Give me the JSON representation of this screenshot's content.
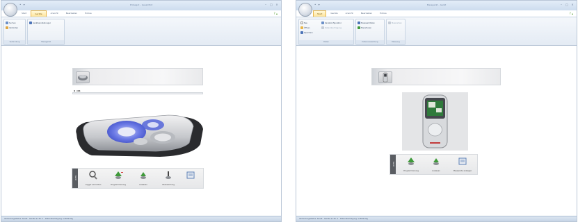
{
  "left_window": {
    "title": "Probegut – Gesamtkit",
    "quick_access": "• ▾",
    "controls": {
      "minimize": "–",
      "maximize": "□",
      "close": "×"
    },
    "tabs": [
      "Start",
      "Geräte",
      "Ansicht",
      "Bearbeiten",
      "Extras"
    ],
    "active_tab": 1,
    "ribbon_help": "? ▴",
    "ribbon_groups": [
      {
        "label": "Verbindung",
        "buttons": [
          "Suchen",
          "Verbinden"
        ]
      },
      {
        "label": "Messgerät",
        "buttons": [
          "Geräteeinstellungen"
        ]
      }
    ],
    "device_header_label": "",
    "progress_label": "0 / 66",
    "toolbar_tab": "Gerät",
    "toolbar_items": [
      {
        "label": "Logger einrichten",
        "icon": "search-icon"
      },
      {
        "label": "Programmierung",
        "icon": "program-icon"
      },
      {
        "label": "Auslesen",
        "icon": "read-icon"
      },
      {
        "label": "Überwachung",
        "icon": "monitor-icon"
      },
      {
        "label": "",
        "icon": "export-icon"
      }
    ],
    "status": "Verbindungsstatus: bereit · Geräte an PC: 1 · Datenübertragung: vollständig"
  },
  "right_window": {
    "title": "Messgerät – Gerät",
    "quick_access": "• ▾",
    "controls": {
      "minimize": "–",
      "maximize": "□",
      "close": "×"
    },
    "tabs": [
      "Start",
      "Geräte",
      "Ansicht",
      "Bearbeiten",
      "Extras"
    ],
    "active_tab": 0,
    "ribbon_help": "? ▴",
    "ribbon_groups": [
      {
        "label": "Daten",
        "buttons": [
          "Neu",
          "Öffnen",
          "Speichern",
          "Kanalkonfiguration",
          "Datenübertragung"
        ]
      },
      {
        "label": "Datenauswertung",
        "buttons": [
          "Messwertdaten",
          "Exportieren"
        ]
      },
      {
        "label": "Messung",
        "buttons": [
          "Messreihen"
        ]
      }
    ],
    "device_header_label": "",
    "toolbar_tab": "Gerät",
    "toolbar_items": [
      {
        "label": "Programmierung",
        "icon": "program-icon"
      },
      {
        "label": "Auslesen",
        "icon": "read-icon"
      },
      {
        "label": "Messwerte anzeigen",
        "icon": "export-icon"
      }
    ],
    "status": "Verbindungsstatus: bereit · Geräte an PC: 1 · Datenübertragung: vollständig"
  },
  "colors": {
    "ribbon_accent": "#ffe49a",
    "device_blue": "#4d5fd8",
    "status_bar": "#c7d5e6",
    "plant_icon": "#3f9a3a"
  }
}
